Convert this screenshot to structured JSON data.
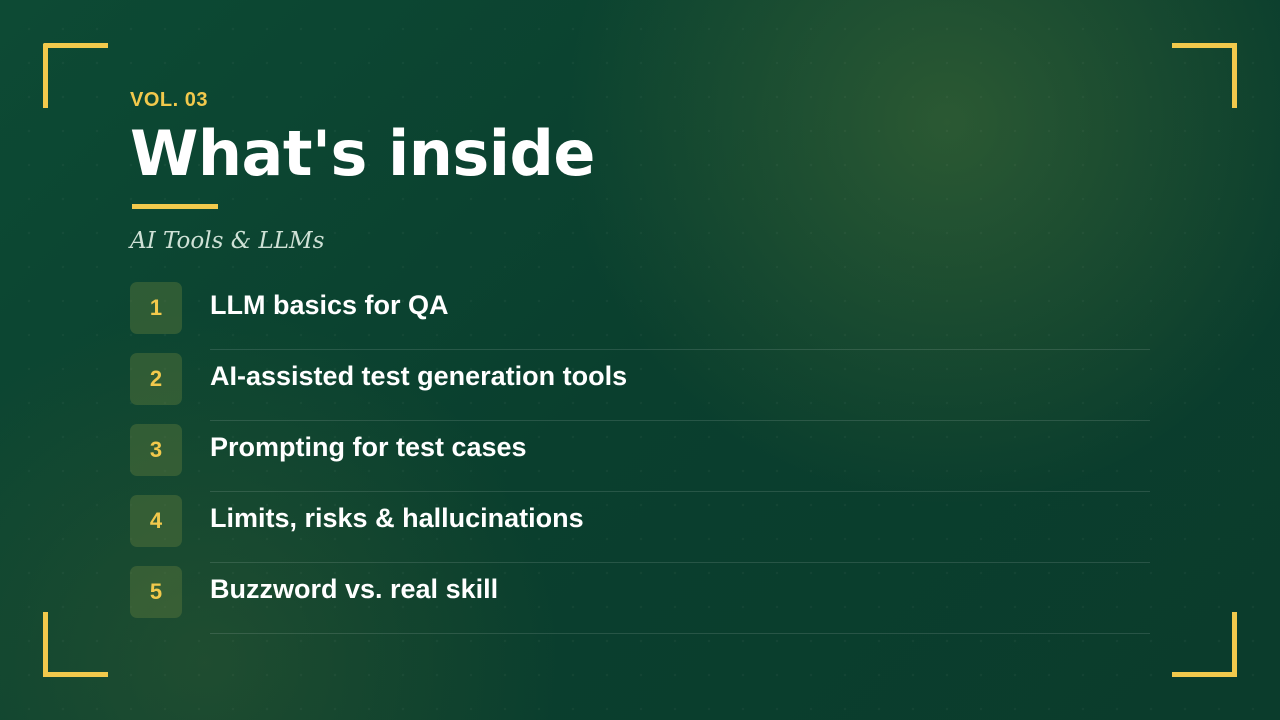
{
  "header": {
    "volume": "VOL. 03",
    "title": "What's inside",
    "subtitle": "AI Tools & LLMs"
  },
  "items": [
    {
      "number": "1",
      "label": "LLM basics for QA"
    },
    {
      "number": "2",
      "label": "AI-assisted test generation tools"
    },
    {
      "number": "3",
      "label": "Prompting for test cases"
    },
    {
      "number": "4",
      "label": "Limits, risks & hallucinations"
    },
    {
      "number": "5",
      "label": "Buzzword vs. real skill"
    }
  ],
  "colors": {
    "accent": "#f2c94c",
    "background": "#0b3f2e",
    "text": "#ffffff"
  }
}
